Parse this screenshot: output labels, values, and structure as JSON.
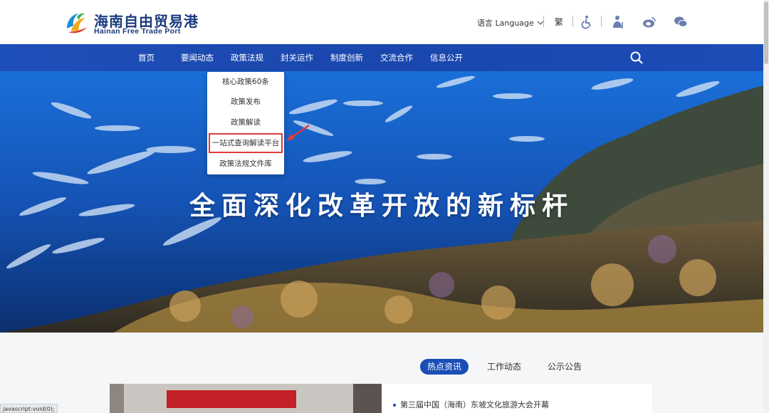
{
  "header": {
    "logo_cn": "海南自由贸易港",
    "logo_en": "Hainan Free Trade Port",
    "language_label": "语言 Language",
    "traditional_label": "繁"
  },
  "nav": {
    "items": [
      {
        "label": "首页"
      },
      {
        "label": "要闻动态"
      },
      {
        "label": "政策法规"
      },
      {
        "label": "封关运作"
      },
      {
        "label": "制度创新"
      },
      {
        "label": "交流合作"
      },
      {
        "label": "信息公开"
      }
    ],
    "active_index": 2
  },
  "dropdown": {
    "items": [
      {
        "label": "核心政策60条"
      },
      {
        "label": "政策发布"
      },
      {
        "label": "政策解读"
      },
      {
        "label": "一站式查询解读平台"
      },
      {
        "label": "政策法规文件库"
      }
    ],
    "highlighted_index": 3
  },
  "hero": {
    "title": "全面深化改革开放的新标杆"
  },
  "tabs": [
    {
      "label": "热点资讯",
      "active": true
    },
    {
      "label": "工作动态",
      "active": false
    },
    {
      "label": "公示公告",
      "active": false
    }
  ],
  "news": [
    {
      "title": "第三届中国（海南）东坡文化旅游大会开幕"
    }
  ],
  "status_bar": "javascript:void(0);",
  "colors": {
    "nav_blue": "#1a47ad",
    "highlight_red": "#e03a3a",
    "tab_active": "#1a4db5"
  }
}
